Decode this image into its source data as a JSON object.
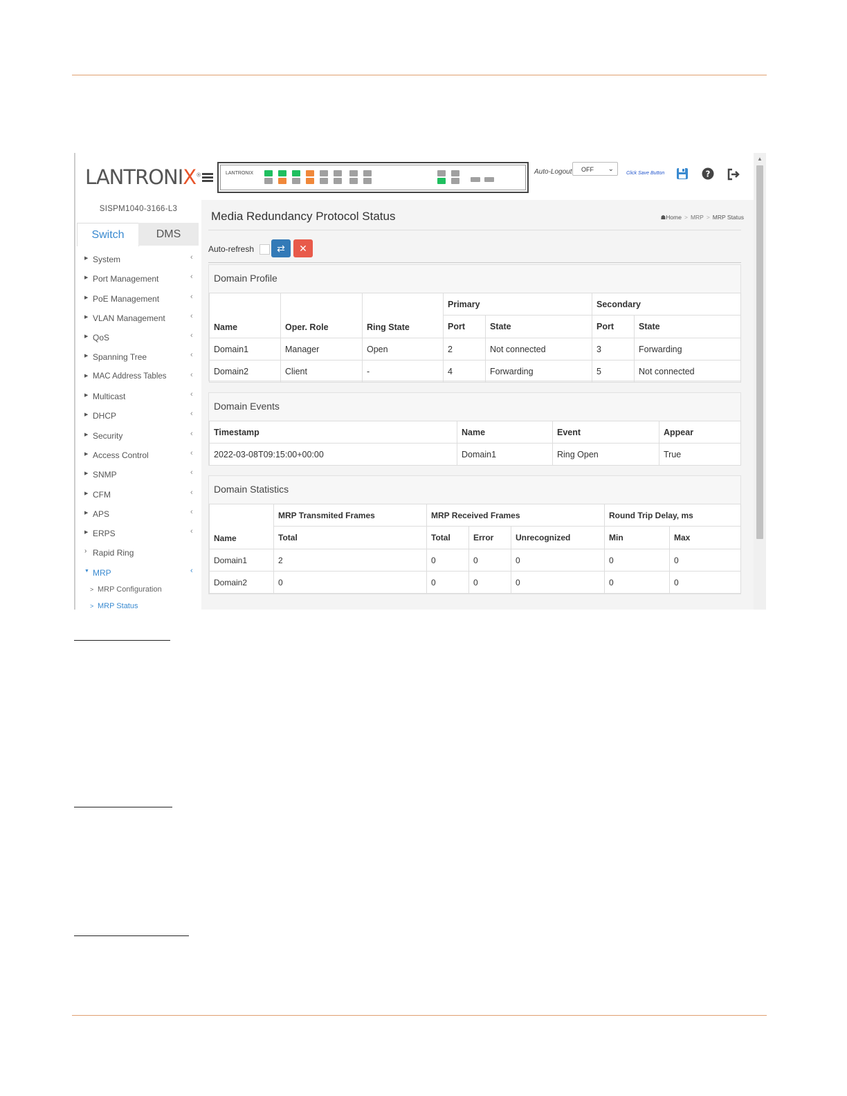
{
  "header": {
    "logo_text": "LANTRONI",
    "logo_x": "X",
    "logo_reg": "®",
    "panel_brand": "LANTRONIX",
    "auto_logout_label": "Auto-Logout",
    "auto_logout_value": "OFF",
    "save_hint": "Click Save Button",
    "icons": [
      "menu-icon",
      "save-icon",
      "help-icon",
      "logout-icon"
    ],
    "port_colors": {
      "green": "#1fbf5f",
      "orange": "#f0883a",
      "gray": "#a0a0a0"
    }
  },
  "sidebar": {
    "model": "SISPM1040-3166-L3",
    "tabs": [
      {
        "label": "Switch"
      },
      {
        "label": "DMS"
      }
    ],
    "items": [
      {
        "label": "System"
      },
      {
        "label": "Port Management"
      },
      {
        "label": "PoE Management"
      },
      {
        "label": "VLAN Management"
      },
      {
        "label": "QoS"
      },
      {
        "label": "Spanning Tree"
      },
      {
        "label": "MAC Address Tables"
      },
      {
        "label": "Multicast"
      },
      {
        "label": "DHCP"
      },
      {
        "label": "Security"
      },
      {
        "label": "Access Control"
      },
      {
        "label": "SNMP"
      },
      {
        "label": "CFM"
      },
      {
        "label": "APS"
      },
      {
        "label": "ERPS"
      },
      {
        "label": "Rapid Ring"
      },
      {
        "label": "MRP"
      }
    ],
    "subitems": [
      {
        "label": "MRP Configuration"
      },
      {
        "label": "MRP Status"
      }
    ],
    "accent": "#3a8ad0"
  },
  "main": {
    "title": "Media Redundancy Protocol Status",
    "breadcrumb": {
      "home": "Home",
      "mid": "MRP",
      "current": "MRP Status"
    },
    "auto_refresh_label": "Auto-refresh",
    "profile": {
      "title": "Domain Profile",
      "group_primary": "Primary",
      "group_secondary": "Secondary",
      "headers": [
        "Name",
        "Oper. Role",
        "Ring State",
        "Port",
        "State",
        "Port",
        "State"
      ],
      "rows": [
        [
          "Domain1",
          "Manager",
          "Open",
          "2",
          "Not connected",
          "3",
          "Forwarding"
        ],
        [
          "Domain2",
          "Client",
          "-",
          "4",
          "Forwarding",
          "5",
          "Not connected"
        ]
      ]
    },
    "events": {
      "title": "Domain Events",
      "headers": [
        "Timestamp",
        "Name",
        "Event",
        "Appear"
      ],
      "rows": [
        [
          "2022-03-08T09:15:00+00:00",
          "Domain1",
          "Ring Open",
          "True"
        ]
      ]
    },
    "stats": {
      "title": "Domain Statistics",
      "group_tx": "MRP Transmited Frames",
      "group_rx": "MRP Received Frames",
      "group_rtd": "Round Trip Delay, ms",
      "headers": [
        "Name",
        "Total",
        "Total",
        "Error",
        "Unrecognized",
        "Min",
        "Max"
      ],
      "rows": [
        [
          "Domain1",
          "2",
          "0",
          "0",
          "0",
          "0",
          "0"
        ],
        [
          "Domain2",
          "0",
          "0",
          "0",
          "0",
          "0",
          "0"
        ]
      ]
    }
  }
}
